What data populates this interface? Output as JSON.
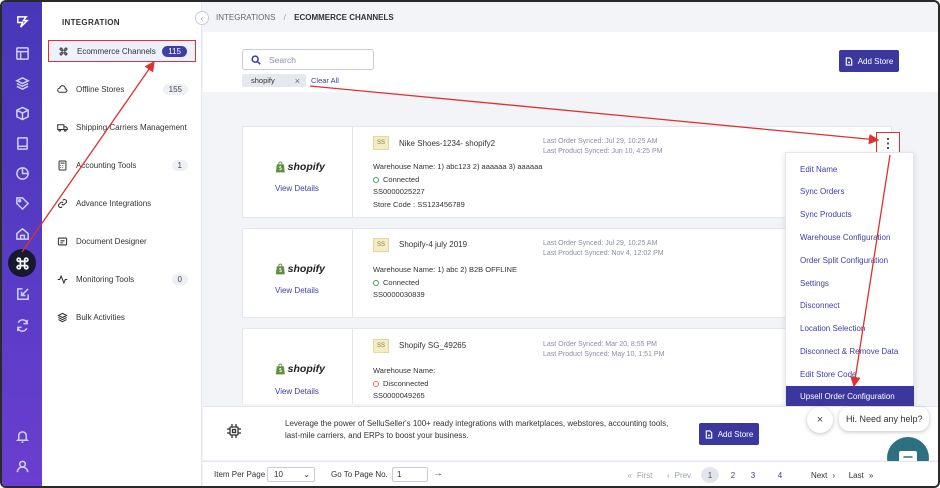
{
  "sidebar": {
    "title": "INTEGRATION",
    "items": [
      {
        "label": "Ecommerce Channels",
        "badge": "115",
        "icon": "command-icon"
      },
      {
        "label": "Offline Stores",
        "badge": "155",
        "icon": "cloud-icon"
      },
      {
        "label": "Shipping Carriers Management",
        "badge": "",
        "icon": "truck-icon"
      },
      {
        "label": "Accounting Tools",
        "badge": "1",
        "icon": "calculator-icon"
      },
      {
        "label": "Advance Integrations",
        "badge": "",
        "icon": "link-icon"
      },
      {
        "label": "Document Designer",
        "badge": "",
        "icon": "document-icon"
      },
      {
        "label": "Monitoring Tools",
        "badge": "0",
        "icon": "pulse-icon"
      },
      {
        "label": "Bulk Activities",
        "badge": "",
        "icon": "layers-icon"
      }
    ]
  },
  "breadcrumb": {
    "parent": "INTEGRATIONS",
    "sep": "/",
    "current": "ECOMMERCE CHANNELS"
  },
  "search": {
    "placeholder": "Search",
    "value": ""
  },
  "filter": {
    "chip": "shopify",
    "chip_close": "×",
    "clear_all": "Clear All"
  },
  "add_store_label": "Add Store",
  "cards": [
    {
      "logo_text": "shopify",
      "view_details": "View Details",
      "ss": "SS",
      "name": "Nike Shoes-1234- shopify2",
      "last_order": "Last Order Synced: Jul 29, 10:25 AM",
      "last_product": "Last Product Synced: Jun 10, 4:25 PM",
      "warehouse": "Warehouse Name: 1) abc123 2) aaaaaa 3) aaaaaa",
      "status": "Connected",
      "code": "SS0000025227",
      "store_code": "Store Code : SS123456789"
    },
    {
      "logo_text": "shopify",
      "view_details": "View Details",
      "ss": "SS",
      "name": "Shopify-4 july 2019",
      "last_order": "Last Order Synced: Jul 29, 10:25 AM",
      "last_product": "Last Product Synced: Nov 4, 12:02 PM",
      "warehouse": "Warehouse Name: 1) abc 2) B2B OFFLINE",
      "status": "Connected",
      "code": "SS0000030839"
    },
    {
      "logo_text": "shopify",
      "view_details": "View Details",
      "ss": "SS",
      "name": "Shopify SG_49265",
      "last_order": "Last Order Synced: Mar 20, 8:55 PM",
      "last_product": "Last Product Synced: May 10, 1:51 PM",
      "warehouse": "Warehouse Name:",
      "status": "Disconnected",
      "code": "SS0000049265"
    }
  ],
  "menu": {
    "items": [
      "Edit Name",
      "Sync Orders",
      "Sync Products",
      "Warehouse Configuration",
      "Order Split Configuration",
      "Settings",
      "Disconnect",
      "Location Selection",
      "Disconnect & Remove Data",
      "Edit Store Code",
      "Upsell Order Configuration"
    ],
    "highlighted": "Upsell Order Configuration"
  },
  "promo": {
    "text": "Leverage the power of SelluSeller's 100+ ready integrations with marketplaces, webstores, accounting tools, last-mile carriers, and ERPs to boost your business."
  },
  "chat": {
    "hint": "Hi. Need any help?",
    "close": "×"
  },
  "footer": {
    "per_page_label": "Item Per Page",
    "per_page_value": "10",
    "goto_label": "Go To Page No.",
    "goto_value": "1",
    "first": "First",
    "prev": "Prev",
    "pages": [
      "1",
      "2",
      "3",
      "4"
    ],
    "current_page": "1",
    "next": "Next",
    "last": "Last"
  },
  "colors": {
    "accent": "#3a389e",
    "rail": "#5a3cc6",
    "annotation": "#e03030",
    "chat": "#2d7081"
  }
}
